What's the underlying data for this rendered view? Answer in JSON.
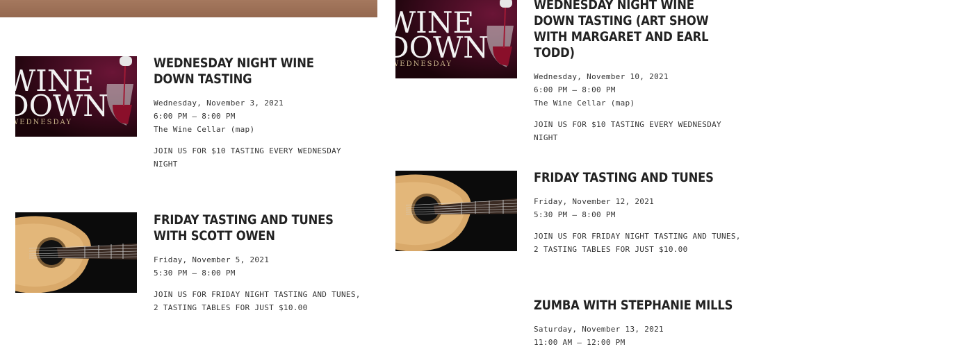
{
  "events": [
    {
      "title": "Wednesday Night Wine Down Tasting",
      "date": "Wednesday, November 3, 2021",
      "time": "6:00 PM – 8:00 PM",
      "venue": "The Wine Cellar",
      "map_link": "(map)",
      "description": "Join us for $10 tasting every Wednesday night",
      "image": "wine-down-image"
    },
    {
      "title": "Friday Tasting and Tunes with Scott Owen",
      "date": "Friday, November 5, 2021",
      "time": "5:30 PM – 8:00 PM",
      "description": "Join us for Friday night tasting and tunes, 2 tasting tables for just $10.00",
      "image": "guitar-image"
    },
    {
      "title": "Wednesday Night Wine Down Tasting (Art show with Margaret and Earl Todd)",
      "date": "Wednesday, November 10, 2021",
      "time": "6:00 PM – 8:00 PM",
      "venue": "The Wine Cellar",
      "map_link": "(map)",
      "description": "Join us for $10 tasting every Wednesday night",
      "image": "wine-down-image"
    },
    {
      "title": "Friday Tasting and Tunes",
      "date": "Friday, November 12, 2021",
      "time": "5:30 PM – 8:00 PM",
      "description": "Join us for Friday night tasting and tunes, 2 tasting tables for just $10.00",
      "image": "guitar-image"
    },
    {
      "title": "Zumba with Stephanie Mills",
      "date": "Saturday, November 13, 2021",
      "time": "11:00 AM – 12:00 PM"
    }
  ],
  "thumb_text": {
    "wine_line1": "WINE",
    "wine_line2": "DOWN",
    "wine_line3": "WEDNESDAY"
  },
  "colors": {
    "banner": "#9c6f56",
    "wine_bg": "#3a0a1c",
    "guitar_bg": "#0b0b0b"
  }
}
